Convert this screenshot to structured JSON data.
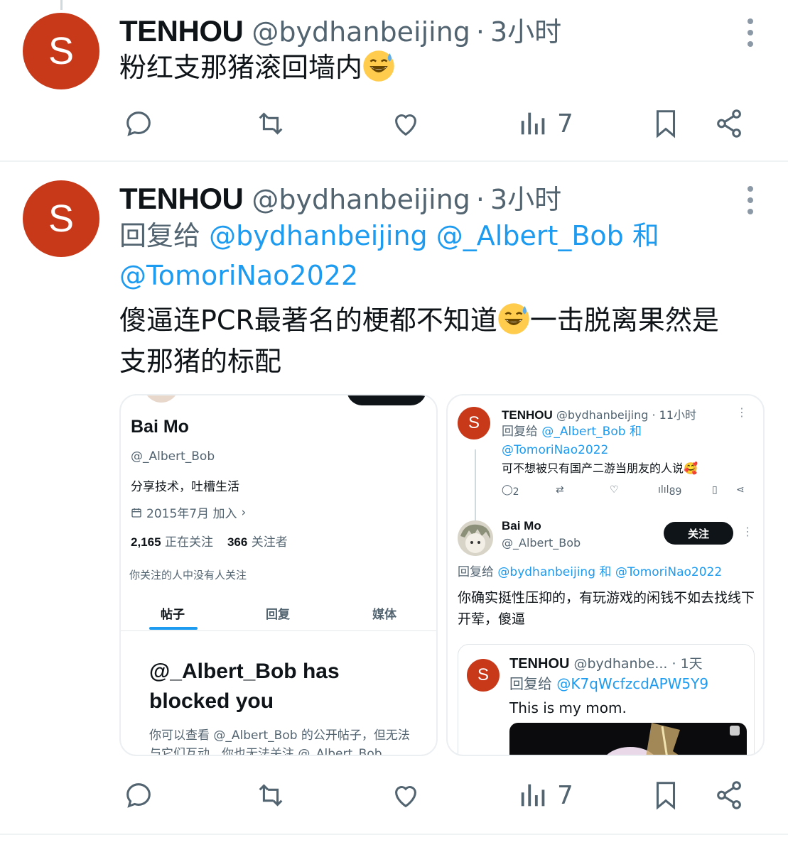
{
  "tweets": [
    {
      "avatar_letter": "S",
      "name": "TENHOU",
      "handle": "@bydhanbeijing",
      "time": "3小时",
      "text": "粉红支那猪滚回墙内",
      "views": "7"
    },
    {
      "avatar_letter": "S",
      "name": "TENHOU",
      "handle": "@bydhanbeijing",
      "time": "3小时",
      "reply_prefix": "回复给",
      "reply_mention_1": "@bydhanbeijing",
      "reply_mention_2": "@_Albert_Bob",
      "reply_and": "和",
      "reply_mention_3": "@TomoriNao2022",
      "text_part1": "傻逼连PCR最著名的梗都不知道",
      "text_part2": "一击脱离果然是支那猪的标配",
      "views": "7"
    }
  ],
  "profile_card": {
    "name": "Bai Mo",
    "handle": "@_Albert_Bob",
    "bio": "分享技术，吐槽生活",
    "joined": "2015年7月 加入",
    "following_count": "2,165",
    "following_label": "正在关注",
    "followers_count": "366",
    "followers_label": "关注者",
    "note": "你关注的人中没有人关注",
    "tabs": [
      "帖子",
      "回复",
      "媒体"
    ],
    "blocked_title": "@_Albert_Bob has blocked you",
    "blocked_desc": "你可以查看 @_Albert_Bob 的公开帖子，但无法与它们互动。你也无法关注 @_Albert_Bob"
  },
  "conversation_card": {
    "first": {
      "avatar_letter": "S",
      "name": "TENHOU",
      "handle": "@bydhanbeijing",
      "time": "· 11小时",
      "reply_prefix": "回复给",
      "reply_mention_1": "@_Albert_Bob",
      "reply_and": "和",
      "reply_mention_2": "@TomoriNao2022",
      "text": "可不想被只有国产二游当朋友的人说🥰",
      "replies": "2",
      "views": "89"
    },
    "second": {
      "name": "Bai Mo",
      "handle": "@_Albert_Bob",
      "follow_label": "关注",
      "reply_prefix": "回复给",
      "reply_mention_1": "@bydhanbeijing",
      "reply_and": "和",
      "reply_mention_2": "@TomoriNao2022",
      "text": "你确实挺性压抑的，有玩游戏的闲钱不如去找线下开荤，傻逼"
    },
    "quoted": {
      "avatar_letter": "S",
      "name": "TENHOU",
      "handle": "@bydhanbe...",
      "time": "· 1天",
      "reply_prefix": "回复给",
      "reply_mention": "@K7qWcfzcdAPW5Y9",
      "text": "This is my mom."
    }
  },
  "colors": {
    "avatar": "#c8391a",
    "mention": "#1d9bf0",
    "secondary_text": "#536471",
    "primary_text": "#0f1419"
  },
  "icons": [
    "reply-icon",
    "retweet-icon",
    "like-icon",
    "views-icon",
    "bookmark-icon",
    "share-icon",
    "more-icon",
    "sweat-smile-emoji"
  ]
}
